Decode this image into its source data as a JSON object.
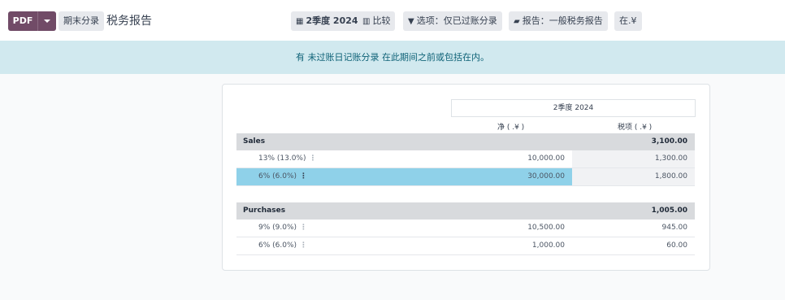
{
  "toolbar": {
    "pdf_label": "PDF",
    "closing_label": "期末分录",
    "title": "税务报告"
  },
  "filters": {
    "period": {
      "icon": "calendar-icon",
      "label": "2季度 2024"
    },
    "compare": {
      "icon": "bar-chart-icon",
      "label": "比较"
    },
    "options": {
      "icon": "filter-icon",
      "label": "选项：仅已过账分录"
    },
    "report": {
      "icon": "book-icon",
      "label": "报告：一般税务报告"
    },
    "currency": {
      "label": "在.¥"
    }
  },
  "alert": {
    "text": "有 未过账日记账分录 在此期间之前或包括在内。"
  },
  "report": {
    "period_header": "2季度 2024",
    "col_net": "净 ( .¥ )",
    "col_tax": "税项 ( .¥ )",
    "sections": [
      {
        "name": "Sales",
        "total": "3,100.00",
        "lines": [
          {
            "label": "13% (13.0%)",
            "net": "10,000.00",
            "tax": "1,300.00"
          },
          {
            "label": "6% (6.0%)",
            "net": "30,000.00",
            "tax": "1,800.00"
          }
        ]
      },
      {
        "name": "Purchases",
        "total": "1,005.00",
        "lines": [
          {
            "label": "9% (9.0%)",
            "net": "10,500.00",
            "tax": "945.00"
          },
          {
            "label": "6% (6.0%)",
            "net": "1,000.00",
            "tax": "60.00"
          }
        ]
      }
    ]
  },
  "colors": {
    "brand": "#714b67",
    "alert_bg": "#d1e9ef",
    "highlight": "#8fd1e9"
  }
}
